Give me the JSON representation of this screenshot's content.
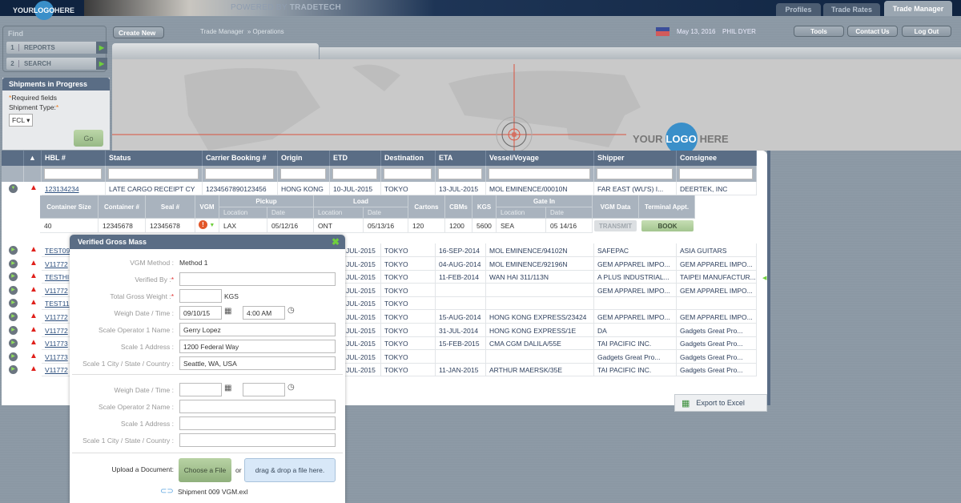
{
  "header": {
    "logo": "YOUR LOGO HERE",
    "logo_parts": [
      "YOUR",
      "LOGO",
      "HERE"
    ],
    "powered_prefix": "POWERED BY",
    "powered_brand": "TRADETECH",
    "tabs": [
      {
        "label": "Profiles"
      },
      {
        "label": "Trade Rates"
      },
      {
        "label": "Trade Manager",
        "active": true
      }
    ],
    "date": "May 13, 2016",
    "user": "PHIL DYER",
    "buttons": [
      "Tools",
      "Contact Us",
      "Log Out"
    ]
  },
  "toolbar": {
    "create_new": "Create New",
    "breadcrumb": [
      "Trade Manager",
      "» Operations"
    ]
  },
  "find": {
    "title": "Find",
    "items": [
      {
        "n": "1",
        "label": "REPORTS"
      },
      {
        "n": "2",
        "label": "SEARCH"
      }
    ]
  },
  "shipments_in_progress": {
    "title": "Shipments in Progress",
    "required": "Required fields",
    "type_label": "Shipment Type:",
    "type_value": "FCL",
    "go": "Go"
  },
  "map_logo": [
    "YOUR",
    "LOGO",
    "HERE"
  ],
  "table": {
    "columns": [
      "HBL #",
      "Status",
      "Carrier Booking #",
      "Origin",
      "ETD",
      "Destination",
      "ETA",
      "Vessel/Voyage",
      "Shipper",
      "Consignee"
    ],
    "expanded_row": {
      "hbl": "123134234",
      "status": "LATE CARGO RECEIPT CY",
      "booking": "1234567890123456",
      "origin": "HONG KONG",
      "etd": "10-JUL-2015",
      "destination": "TOKYO",
      "eta": "13-JUL-2015",
      "vessel": "MOL EMINENCE/00010N",
      "shipper": "FAR EAST (WU'S) I...",
      "consignee": "DEERTEK, INC"
    },
    "rows": [
      {
        "hbl": "TEST09",
        "etd": "JUL-2015",
        "destination": "TOKYO",
        "eta": "16-SEP-2014",
        "vessel": "MOL EMINENCE/94102N",
        "shipper": "SAFEPAC",
        "consignee": "ASIA GUITARS"
      },
      {
        "hbl": "V11772",
        "etd": "JUL-2015",
        "destination": "TOKYO",
        "eta": "04-AUG-2014",
        "vessel": "MOL EMINENCE/92196N",
        "shipper": "GEM APPAREL IMPO...",
        "consignee": "GEM APPAREL IMPO..."
      },
      {
        "hbl": "TESTHI",
        "etd": "JUL-2015",
        "destination": "TOKYO",
        "eta": "11-FEB-2014",
        "vessel": "WAN HAI 311/113N",
        "shipper": "A PLUS INDUSTRIAL...",
        "consignee": "TAIPEI MANUFACTUR..."
      },
      {
        "hbl": "V11772",
        "etd": "JUL-2015",
        "destination": "TOKYO",
        "eta": "",
        "vessel": "",
        "shipper": "GEM APPAREL IMPO...",
        "consignee": "GEM APPAREL IMPO..."
      },
      {
        "hbl": "TEST11",
        "etd": "JUL-2015",
        "destination": "TOKYO",
        "eta": "",
        "vessel": "",
        "shipper": "",
        "consignee": ""
      },
      {
        "hbl": "V11772",
        "etd": "JUL-2015",
        "destination": "TOKYO",
        "eta": "15-AUG-2014",
        "vessel": "HONG KONG EXPRESS/23424",
        "shipper": "GEM APPAREL IMPO...",
        "consignee": "GEM APPAREL IMPO..."
      },
      {
        "hbl": "V11772",
        "etd": "JUL-2015",
        "destination": "TOKYO",
        "eta": "31-JUL-2014",
        "vessel": "HONG KONG EXPRESS/1E",
        "shipper": "DA",
        "consignee": "Gadgets Great Pro..."
      },
      {
        "hbl": "V11773",
        "etd": "JUL-2015",
        "destination": "TOKYO",
        "eta": "15-FEB-2015",
        "vessel": "CMA CGM DALILA/55E",
        "shipper": "TAI PACIFIC INC.",
        "consignee": "Gadgets Great Pro..."
      },
      {
        "hbl": "V11773",
        "etd": "JUL-2015",
        "destination": "TOKYO",
        "eta": "",
        "vessel": "",
        "shipper": "Gadgets Great Pro...",
        "consignee": "Gadgets Great Pro..."
      },
      {
        "hbl": "V11772",
        "etd": "JUL-2015",
        "destination": "TOKYO",
        "eta": "11-JAN-2015",
        "vessel": "ARTHUR MAERSK/35E",
        "shipper": "TAI PACIFIC INC.",
        "consignee": "Gadgets Great Pro..."
      }
    ]
  },
  "container": {
    "headers": {
      "size": "Container Size",
      "number": "Container #",
      "seal": "Seal #",
      "vgm": "VGM",
      "pickup": "Pickup",
      "load": "Load",
      "cartons": "Cartons",
      "cbms": "CBMs",
      "kgs": "KGS",
      "gate_in": "Gate In",
      "location": "Location",
      "date": "Date",
      "vgm_data": "VGM Data",
      "terminal": "Terminal Appt."
    },
    "row": {
      "size": "40",
      "number": "12345678",
      "seal": "12345678",
      "pickup_loc": "LAX",
      "pickup_date": "05/12/16",
      "load_loc": "ONT",
      "load_date": "05/13/16",
      "cartons": "120",
      "cbms": "1200",
      "kgs": "5600",
      "gate_loc": "SEA",
      "gate_date": "05 14/16",
      "transmit": "TRANSMIT",
      "book": "BOOK"
    }
  },
  "vgm_modal": {
    "title": "Verified Gross Mass",
    "method_label": "VGM Method :",
    "method_value": "Method 1",
    "verified_by": "Verified By :",
    "verified_by_value": "",
    "total_weight": "Total Gross Weight :",
    "total_weight_value": "",
    "unit": "KGS",
    "weigh_dt": "Weigh Date / Time :",
    "weigh_date": "09/10/15",
    "weigh_time": "4:00 AM",
    "op1_label": "Scale Operator 1 Name :",
    "op1": "Gerry Lopez",
    "addr1_label": "Scale 1 Address :",
    "addr1": "1200 Federal Way",
    "city1_label": "Scale 1 City / State / Country :",
    "city1": "Seattle, WA, USA",
    "weigh_dt2": "Weigh Date / Time :",
    "op2_label": "Scale Operator 2 Name :",
    "addr2_label": "Scale 1 Address :",
    "city2_label": "Scale 1 City / State / Country :",
    "upload_label": "Upload a Document:",
    "choose": "Choose a File",
    "or": "or",
    "drop": "drag & drop a file here.",
    "file": "Shipment 009 VGM.exl"
  },
  "export": "Export to Excel",
  "colors": {
    "header_navy": "#0f2340",
    "table_header": "#5a6d85",
    "accent_green": "#6fcf3d",
    "alert_red": "#e0201b",
    "logo_blue": "#3a8fc9"
  }
}
